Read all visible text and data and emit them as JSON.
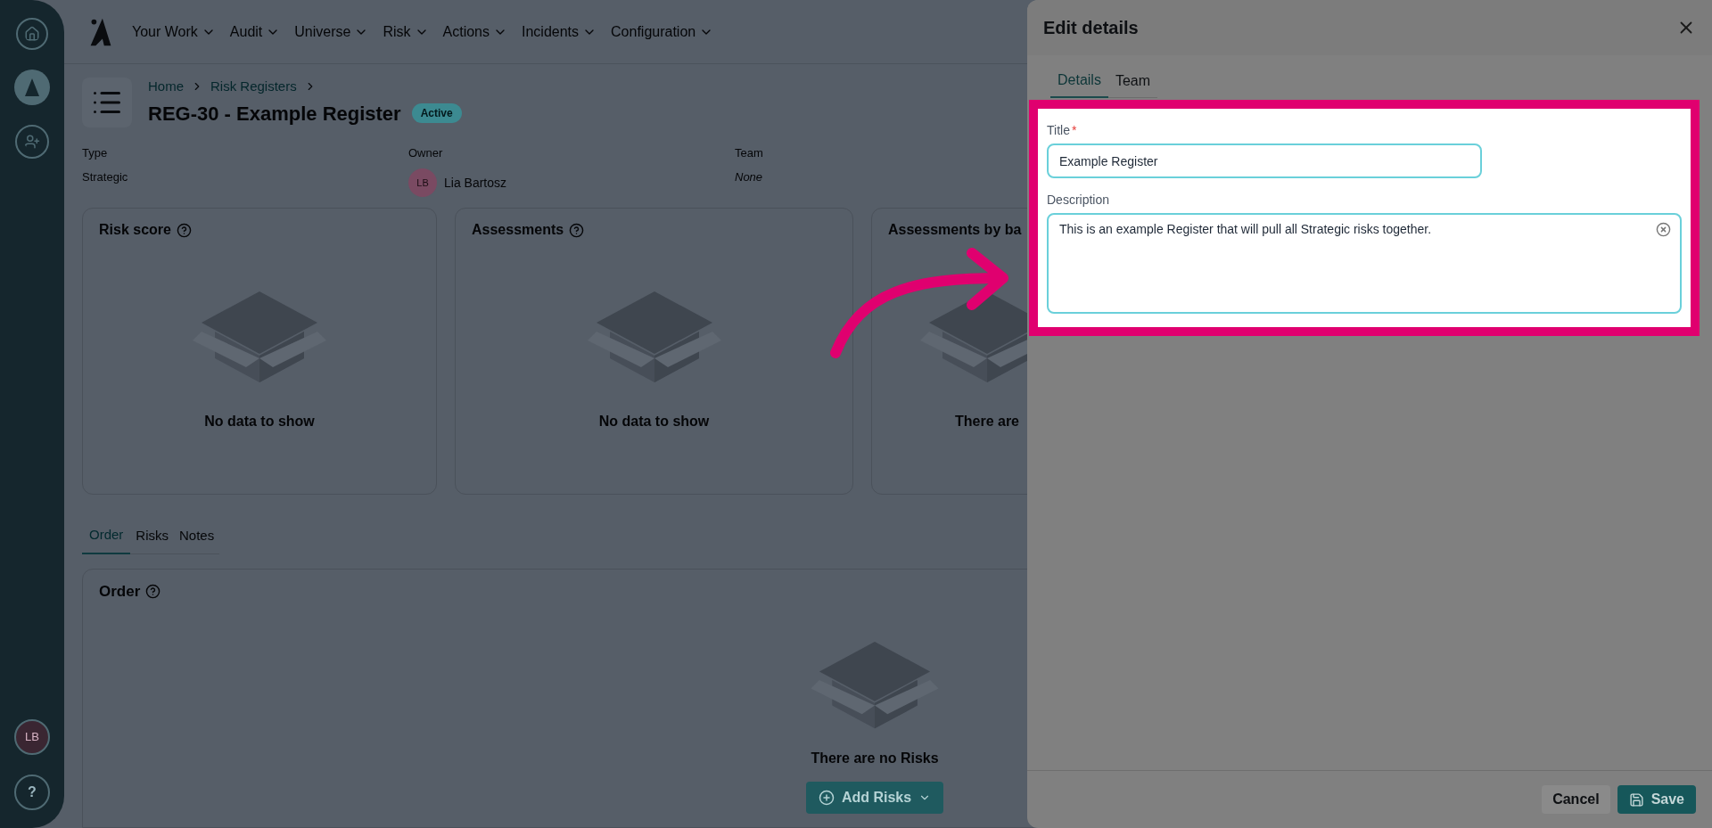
{
  "sidebar": {
    "user_initials": "LB",
    "help": "?"
  },
  "nav": {
    "items": [
      "Your Work",
      "Audit",
      "Universe",
      "Risk",
      "Actions",
      "Incidents",
      "Configuration"
    ]
  },
  "header": {
    "breadcrumbs": [
      "Home",
      "Risk Registers"
    ],
    "title": "REG-30 - Example Register",
    "status": "Active"
  },
  "fields": [
    {
      "label": "Type",
      "value": "Strategic",
      "kind": "text"
    },
    {
      "label": "Owner",
      "value": "Lia Bartosz",
      "initials": "LB",
      "kind": "user"
    },
    {
      "label": "Team",
      "value": "None",
      "kind": "empty"
    }
  ],
  "cards": [
    {
      "title": "Risk score",
      "help_icon": true,
      "message": "No data to show"
    },
    {
      "title": "Assessments",
      "help_icon": true,
      "message": "No data to show"
    },
    {
      "title": "Assessments by ba",
      "help_icon": false,
      "message": "There are"
    }
  ],
  "tabs": [
    {
      "label": "Order",
      "selected": true
    },
    {
      "label": "Risks",
      "selected": false
    },
    {
      "label": "Notes",
      "selected": false
    }
  ],
  "order": {
    "title": "Order",
    "message": "There are no Risks",
    "button": "Add Risks"
  },
  "panel": {
    "title": "Edit details",
    "tabs": [
      {
        "label": "Details",
        "selected": true
      },
      {
        "label": "Team",
        "selected": false
      }
    ],
    "title_label": "Title",
    "required_mark": "*",
    "title_value": "Example Register",
    "description_label": "Description",
    "description_value": "This is an example Register that will pull all Strategic risks together.",
    "cancel": "Cancel",
    "save": "Save"
  }
}
